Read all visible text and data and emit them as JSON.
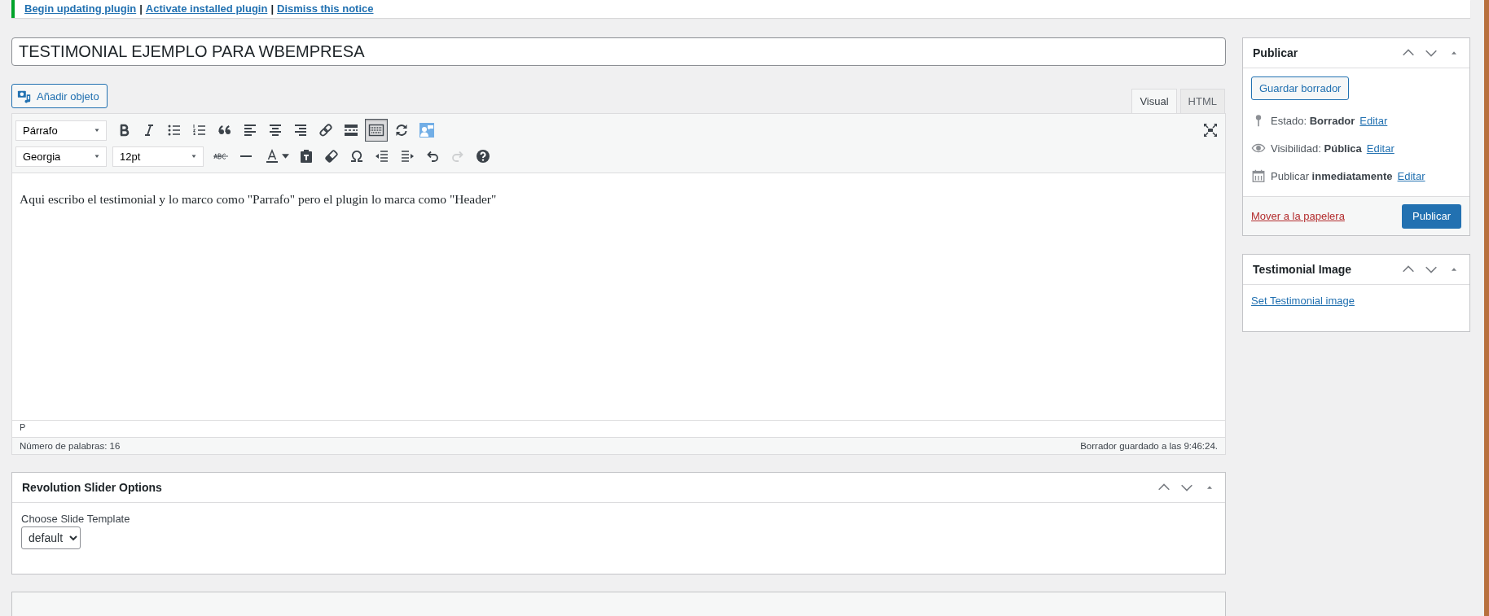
{
  "notice": {
    "links": [
      "Begin updating plugin",
      "Activate installed plugin",
      "Dismiss this notice"
    ],
    "separators": [
      "|",
      "|"
    ]
  },
  "post_title": {
    "value": "TESTIMONIAL EJEMPLO PARA WBEMPRESA"
  },
  "add_media_button": "Añadir objeto",
  "editor_tabs": [
    {
      "label": "Visual",
      "selected": true
    },
    {
      "label": "HTML",
      "selected": false
    }
  ],
  "toolbar": {
    "rows": [
      {
        "selects": [
          "Párrafo"
        ],
        "buttons": [
          {
            "kind": "bold",
            "active": false,
            "disabled": false
          },
          {
            "kind": "italic",
            "active": false,
            "disabled": false
          },
          {
            "kind": "bullet-list",
            "active": false,
            "disabled": false
          },
          {
            "kind": "numbered-list",
            "active": false,
            "disabled": false
          },
          {
            "kind": "blockquote",
            "active": false,
            "disabled": false
          },
          {
            "kind": "align-left",
            "active": false,
            "disabled": false
          },
          {
            "kind": "align-center",
            "active": false,
            "disabled": false
          },
          {
            "kind": "align-right",
            "active": false,
            "disabled": false
          },
          {
            "kind": "link",
            "active": false,
            "disabled": false
          },
          {
            "kind": "more",
            "active": false,
            "disabled": false
          },
          {
            "kind": "toolbar-toggle",
            "active": true,
            "disabled": false
          },
          {
            "kind": "sync",
            "active": false,
            "disabled": false
          },
          {
            "kind": "person-card",
            "active": false,
            "disabled": false
          },
          {
            "kind": "fullscreen",
            "active": false,
            "disabled": false
          }
        ]
      },
      {
        "selects": [
          "Georgia",
          "12pt"
        ],
        "buttons": [
          {
            "kind": "strikethrough",
            "active": false,
            "disabled": false
          },
          {
            "kind": "horizontal-line",
            "active": false,
            "disabled": false
          },
          {
            "kind": "text-color",
            "active": false,
            "disabled": false
          },
          {
            "kind": "paste-text",
            "active": false,
            "disabled": false
          },
          {
            "kind": "clear-formatting",
            "active": false,
            "disabled": false
          },
          {
            "kind": "special-character",
            "active": false,
            "disabled": false
          },
          {
            "kind": "outdent",
            "active": false,
            "disabled": false
          },
          {
            "kind": "indent",
            "active": false,
            "disabled": false
          },
          {
            "kind": "undo",
            "active": false,
            "disabled": false
          },
          {
            "kind": "redo",
            "active": false,
            "disabled": true
          },
          {
            "kind": "help",
            "active": false,
            "disabled": false
          }
        ]
      }
    ]
  },
  "content": "Aqui escribo el testimonial y lo marco como \"Parrafo\" pero el plugin lo marca como \"Header\"",
  "path": "P",
  "word_count": "Número de palabras: 16",
  "autosave": "Borrador guardado a las 9:46:24.",
  "revslider": {
    "title": "Revolution Slider Options",
    "label": "Choose Slide Template",
    "select": "default"
  },
  "publish": {
    "title": "Publicar",
    "save_draft": "Guardar borrador",
    "rows": [
      {
        "kind": "status",
        "label": "Estado:",
        "value": "Borrador",
        "link": "Editar"
      },
      {
        "kind": "visibility",
        "label": "Visibilidad:",
        "value": "Pública",
        "link": "Editar"
      },
      {
        "kind": "schedule",
        "label": "Publicar",
        "value": "inmediatamente",
        "link": "Editar"
      }
    ],
    "trash": "Mover a la papelera",
    "publish_button": "Publicar"
  },
  "testimonial_image": {
    "title": "Testimonial Image",
    "link": "Set Testimonial image"
  }
}
